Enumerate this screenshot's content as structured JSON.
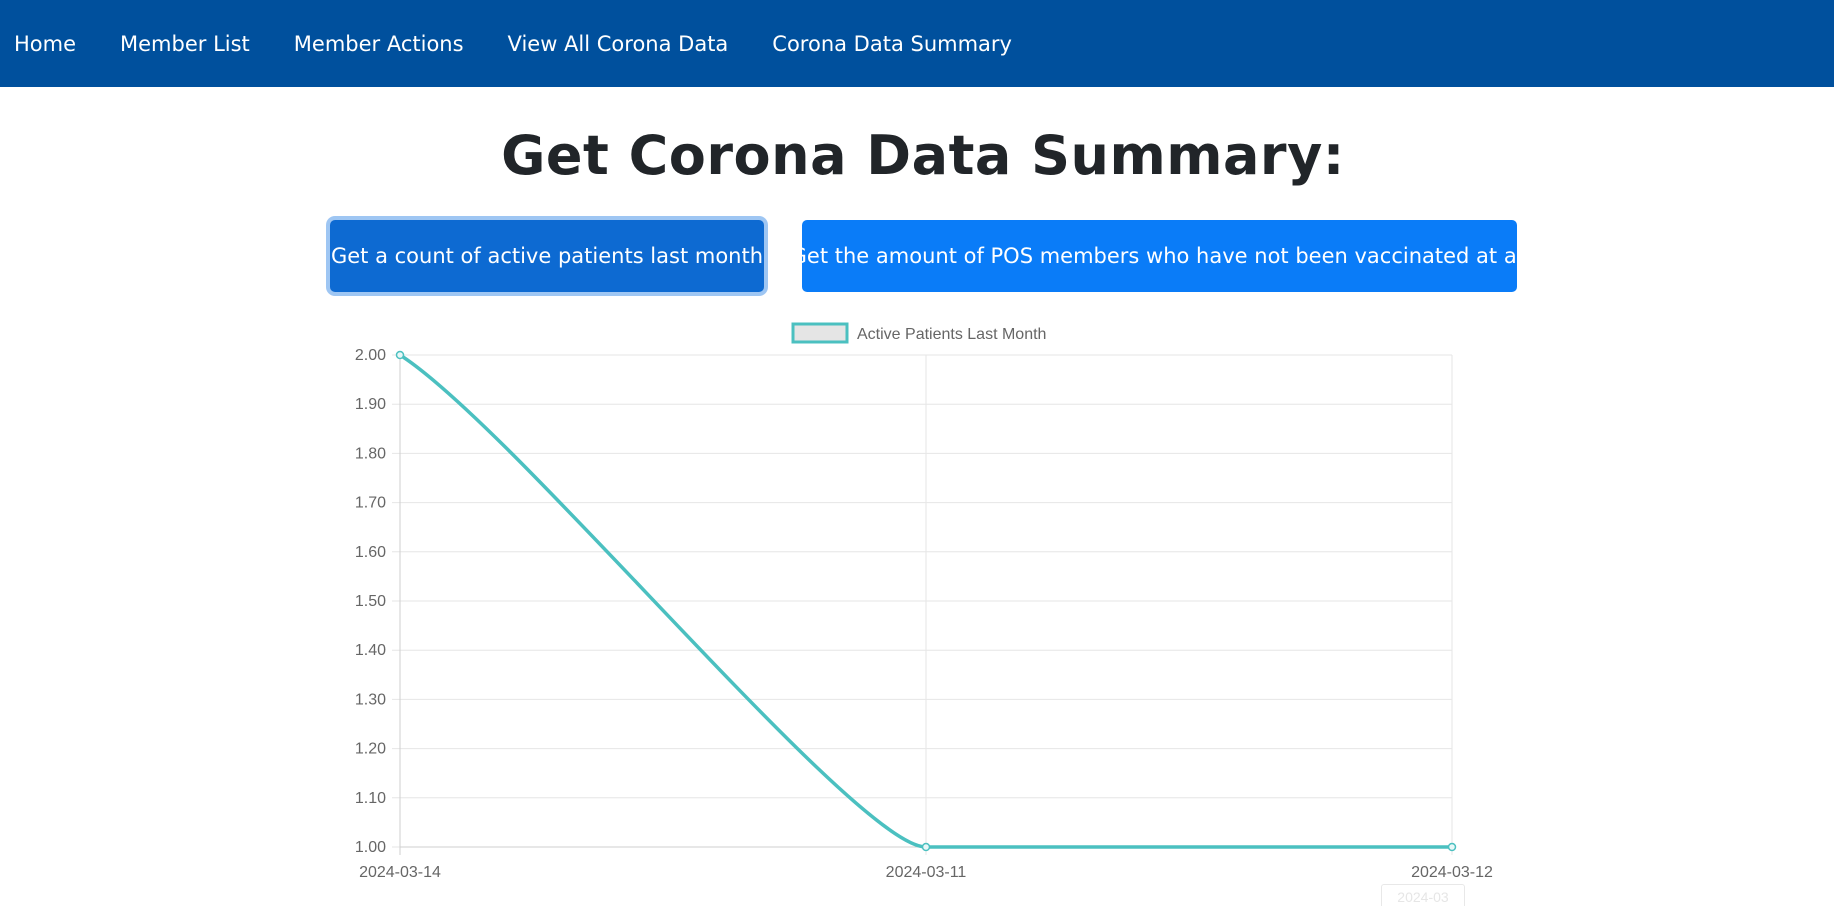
{
  "nav": {
    "items": [
      {
        "label": "Home"
      },
      {
        "label": "Member List"
      },
      {
        "label": "Member Actions"
      },
      {
        "label": "View All Corona Data"
      },
      {
        "label": "Corona Data Summary"
      }
    ]
  },
  "main": {
    "title": "Get Corona Data Summary:",
    "buttons": {
      "active_patients": "Get a count of active patients last month",
      "unvaccinated": "Get the amount of POS members who have not been vaccinated at all"
    }
  },
  "ghost_tag": "2024-03",
  "colors": {
    "navbar": "#00509d",
    "button": "#0a7cf8",
    "button_active": "#0d6ad2",
    "series_line": "#4bc0c0",
    "legend_fill": "#e5e5e5"
  },
  "chart_data": {
    "type": "line",
    "title": "",
    "xlabel": "",
    "ylabel": "",
    "categories": [
      "2024-03-14",
      "2024-03-11",
      "2024-03-12"
    ],
    "series": [
      {
        "name": "Active Patients Last Month",
        "values": [
          2,
          1,
          1
        ]
      }
    ],
    "ylim": [
      1.0,
      2.0
    ],
    "yticks": [
      "2.00",
      "1.90",
      "1.80",
      "1.70",
      "1.60",
      "1.50",
      "1.40",
      "1.30",
      "1.20",
      "1.10",
      "1.00"
    ],
    "grid": true,
    "legend": "top-center"
  }
}
